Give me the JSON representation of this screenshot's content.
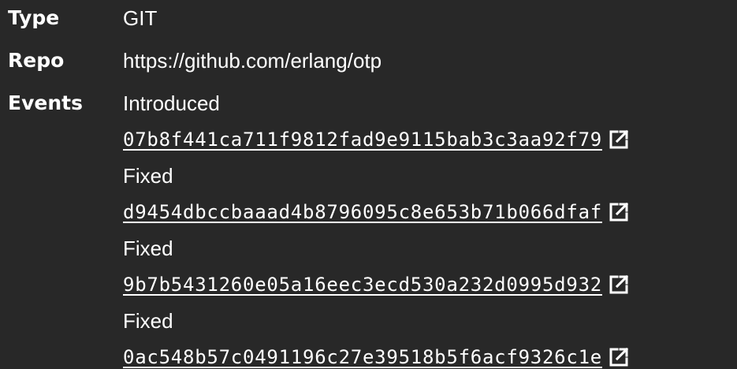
{
  "rows": {
    "type": {
      "label": "Type",
      "value": "GIT"
    },
    "repo": {
      "label": "Repo",
      "value": "https://github.com/erlang/otp"
    },
    "events": {
      "label": "Events",
      "items": [
        {
          "kind": "Introduced",
          "commit": "07b8f441ca711f9812fad9e9115bab3c3aa92f79"
        },
        {
          "kind": "Fixed",
          "commit": "d9454dbccbaaad4b8796095c8e653b71b066dfaf"
        },
        {
          "kind": "Fixed",
          "commit": "9b7b5431260e05a16eec3ecd530a232d0995d932"
        },
        {
          "kind": "Fixed",
          "commit": "0ac548b57c0491196c27e39518b5f6acf9326c1e"
        }
      ]
    }
  },
  "icons": {
    "external_link": "external-link-icon"
  },
  "colors": {
    "background": "#282828",
    "text": "#ffffff"
  }
}
